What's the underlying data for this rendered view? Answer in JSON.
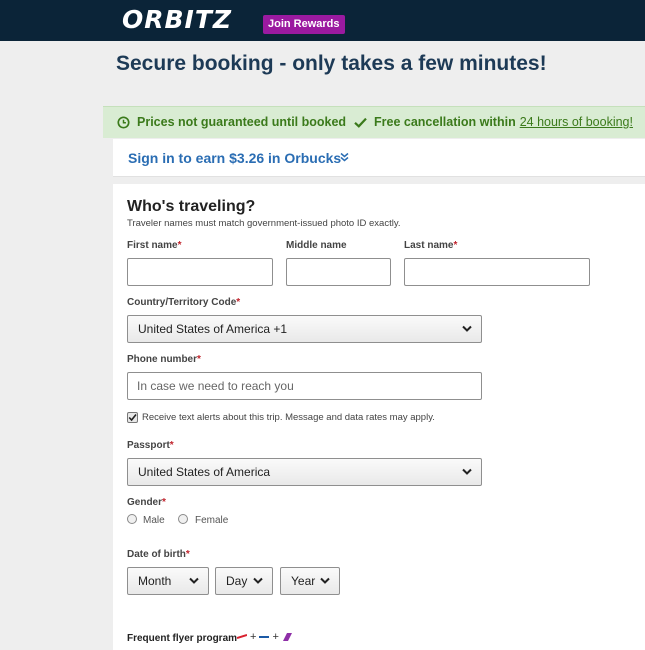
{
  "header": {
    "logo": "ORBITZ",
    "join_label": "Join Rewards"
  },
  "page_title": "Secure booking - only takes a few minutes!",
  "banner": {
    "left": "Prices not guaranteed until booked",
    "right_prefix": "Free cancellation within",
    "right_link": "24 hours of booking!"
  },
  "signin": {
    "text": "Sign in to earn $3.26 in Orbucks"
  },
  "form": {
    "title": "Who's traveling?",
    "note": "Traveler names must match government-issued photo ID exactly.",
    "first_name_label": "First name",
    "middle_name_label": "Middle name",
    "last_name_label": "Last name",
    "country_label": "Country/Territory Code",
    "country_value": "United States of America +1",
    "phone_label": "Phone number",
    "phone_placeholder": "In case we need to reach you",
    "text_alerts": "Receive text alerts about this trip. Message and data rates may apply.",
    "passport_label": "Passport",
    "passport_value": "United States of America",
    "gender_label": "Gender",
    "gender_male": "Male",
    "gender_female": "Female",
    "dob_label": "Date of birth",
    "dob_month": "Month",
    "dob_day": "Day",
    "dob_year": "Year",
    "frequent_flyer_label": "Frequent flyer program",
    "required_mark": "*"
  },
  "colors": {
    "topbar": "#0b2438",
    "join_badge": "#9b1aa0",
    "banner_bg": "#d9ecd3",
    "banner_text": "#3b7a1b",
    "link_blue": "#2a6db3",
    "required": "#c0232c"
  }
}
